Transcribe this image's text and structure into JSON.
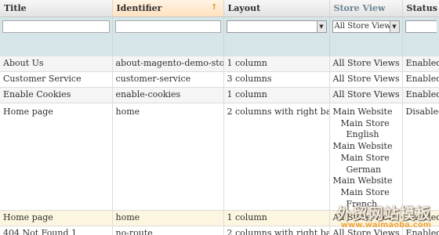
{
  "columns": {
    "title": "Title",
    "identifier": "Identifier",
    "identifier_sort_icon": "↑",
    "layout": "Layout",
    "store_view": "Store View",
    "status": "Status"
  },
  "filters": {
    "store_view_selected": "All Store Views",
    "dropdown_icon": "▼"
  },
  "rows": [
    {
      "title": "About Us",
      "identifier": "about-magento-demo-store",
      "layout": "1 column",
      "store_view": "All Store Views",
      "status": "Enabled"
    },
    {
      "title": "Customer Service",
      "identifier": "customer-service",
      "layout": "3 columns",
      "store_view": "All Store Views",
      "status": "Enabled"
    },
    {
      "title": "Enable Cookies",
      "identifier": "enable-cookies",
      "layout": "1 column",
      "store_view": "All Store Views",
      "status": "Enabled"
    },
    {
      "title": "Home page",
      "identifier": "home",
      "layout": "2 columns with right bar",
      "status": "Disabled",
      "store_views": [
        {
          "website": "Main Website",
          "store": "Main Store",
          "view": "English"
        },
        {
          "website": "Main Website",
          "store": "Main Store",
          "view": "German"
        },
        {
          "website": "Main Website",
          "store": "Main Store",
          "view": "French"
        }
      ]
    },
    {
      "title": "Home page",
      "identifier": "home",
      "layout": "1 column",
      "store_view": "All Store Views",
      "status": "Enabled"
    },
    {
      "title": "404 Not Found 1",
      "identifier": "no-route",
      "layout": "2 columns with right bar",
      "store_view": "All Store Views",
      "status": "Enabled"
    }
  ],
  "watermark": {
    "line1": "外贸网站模板",
    "line2": "www.waimaoba.com"
  }
}
